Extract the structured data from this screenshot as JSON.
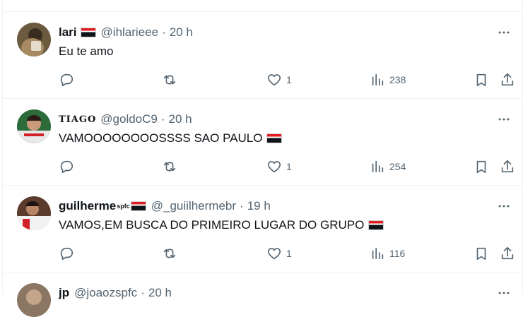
{
  "tweets": [
    {
      "name": "lari",
      "handle": "@ihlarieee",
      "time": "20 h",
      "text": "Eu te amo",
      "likes": "1",
      "views": "238"
    },
    {
      "name": "TIAGO",
      "handle": "@goldoC9",
      "time": "20 h",
      "text": "VAMOOOOOOOOSSSS SAO PAULO",
      "likes": "1",
      "views": "254"
    },
    {
      "name": "guilherme",
      "name_sup": "spfc",
      "handle": "@_guiilhermebr",
      "time": "19 h",
      "text": "VAMOS,EM BUSCA DO PRIMEIRO LUGAR DO GRUPO",
      "likes": "1",
      "views": "116"
    },
    {
      "name": "jp",
      "handle": "@joaozspfc",
      "time": "20 h"
    }
  ],
  "separator": "·",
  "colors": {
    "text": "#0f1419",
    "muted": "#536471",
    "border": "#eff3f4",
    "flag_red": "#e11b22",
    "flag_black": "#0f1419"
  },
  "icons": [
    "reply-icon",
    "retweet-icon",
    "heart-icon",
    "views-icon",
    "bookmark-icon",
    "share-icon",
    "more-icon"
  ]
}
